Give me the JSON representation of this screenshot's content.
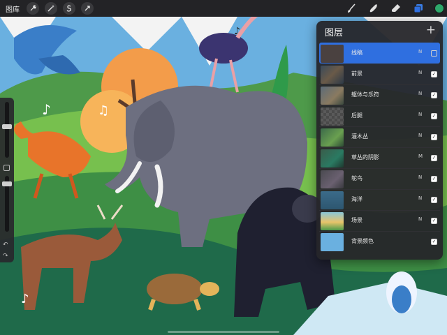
{
  "toolbar": {
    "gallery_label": "图库",
    "left_tools": [
      {
        "name": "wrench-icon"
      },
      {
        "name": "magic-wand-icon"
      },
      {
        "name": "selection-s-icon"
      },
      {
        "name": "transform-arrow-icon"
      }
    ],
    "right_tools": [
      {
        "name": "brush-icon"
      },
      {
        "name": "smudge-icon"
      },
      {
        "name": "eraser-icon"
      },
      {
        "name": "layers-icon"
      }
    ],
    "active_color": "#2ea86b"
  },
  "layers_panel": {
    "title": "图层",
    "add_label": "+",
    "layers": [
      {
        "name": "线稿",
        "mode": "N",
        "visible": false,
        "selected": true,
        "thumb": "t-sketch"
      },
      {
        "name": "前景",
        "mode": "N",
        "visible": true,
        "selected": false,
        "thumb": "t-fore"
      },
      {
        "name": "躯体与乐符",
        "mode": "N",
        "visible": true,
        "selected": false,
        "thumb": "t-body"
      },
      {
        "name": "后腿",
        "mode": "N",
        "visible": true,
        "selected": false,
        "thumb": "t-leg"
      },
      {
        "name": "灌木丛",
        "mode": "N",
        "visible": true,
        "selected": false,
        "thumb": "t-shrub"
      },
      {
        "name": "草丛的阴影",
        "mode": "M",
        "visible": true,
        "selected": false,
        "thumb": "t-shadow"
      },
      {
        "name": "鸵鸟",
        "mode": "N",
        "visible": true,
        "selected": false,
        "thumb": "t-ostrich"
      },
      {
        "name": "海洋",
        "mode": "N",
        "visible": true,
        "selected": false,
        "thumb": "t-ocean"
      },
      {
        "name": "场景",
        "mode": "N",
        "visible": true,
        "selected": false,
        "thumb": "t-scene"
      },
      {
        "name": "背景颜色",
        "mode": "",
        "visible": true,
        "selected": false,
        "thumb": "t-bg"
      }
    ]
  },
  "sidebar": {
    "brush_size_level": 0.7,
    "opacity_level": 0.35
  },
  "colors": {
    "accent": "#2f6fe0",
    "panel_bg": "#26262a",
    "toolbar_bg": "#232326"
  }
}
